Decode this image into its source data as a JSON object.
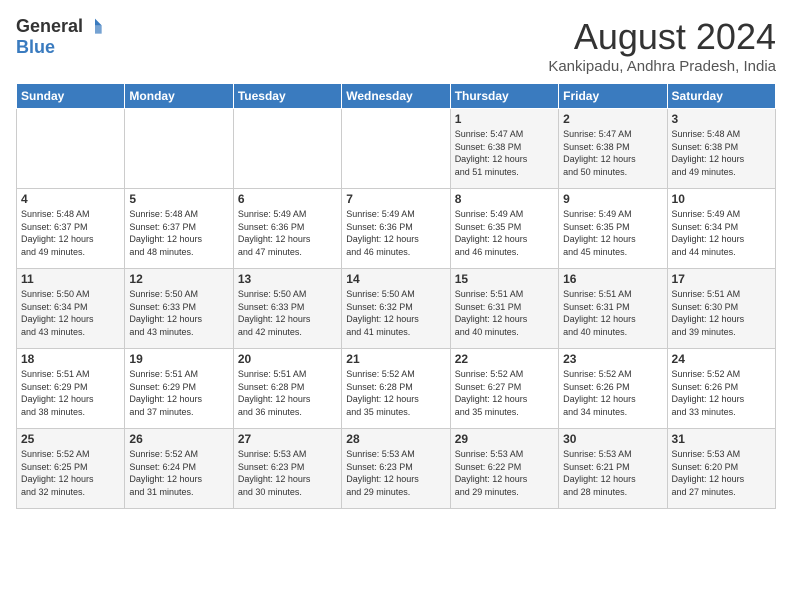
{
  "logo": {
    "general": "General",
    "blue": "Blue"
  },
  "title": {
    "month_year": "August 2024",
    "location": "Kankipadu, Andhra Pradesh, India"
  },
  "days_of_week": [
    "Sunday",
    "Monday",
    "Tuesday",
    "Wednesday",
    "Thursday",
    "Friday",
    "Saturday"
  ],
  "weeks": [
    [
      {
        "day": "",
        "info": ""
      },
      {
        "day": "",
        "info": ""
      },
      {
        "day": "",
        "info": ""
      },
      {
        "day": "",
        "info": ""
      },
      {
        "day": "1",
        "info": "Sunrise: 5:47 AM\nSunset: 6:38 PM\nDaylight: 12 hours\nand 51 minutes."
      },
      {
        "day": "2",
        "info": "Sunrise: 5:47 AM\nSunset: 6:38 PM\nDaylight: 12 hours\nand 50 minutes."
      },
      {
        "day": "3",
        "info": "Sunrise: 5:48 AM\nSunset: 6:38 PM\nDaylight: 12 hours\nand 49 minutes."
      }
    ],
    [
      {
        "day": "4",
        "info": "Sunrise: 5:48 AM\nSunset: 6:37 PM\nDaylight: 12 hours\nand 49 minutes."
      },
      {
        "day": "5",
        "info": "Sunrise: 5:48 AM\nSunset: 6:37 PM\nDaylight: 12 hours\nand 48 minutes."
      },
      {
        "day": "6",
        "info": "Sunrise: 5:49 AM\nSunset: 6:36 PM\nDaylight: 12 hours\nand 47 minutes."
      },
      {
        "day": "7",
        "info": "Sunrise: 5:49 AM\nSunset: 6:36 PM\nDaylight: 12 hours\nand 46 minutes."
      },
      {
        "day": "8",
        "info": "Sunrise: 5:49 AM\nSunset: 6:35 PM\nDaylight: 12 hours\nand 46 minutes."
      },
      {
        "day": "9",
        "info": "Sunrise: 5:49 AM\nSunset: 6:35 PM\nDaylight: 12 hours\nand 45 minutes."
      },
      {
        "day": "10",
        "info": "Sunrise: 5:49 AM\nSunset: 6:34 PM\nDaylight: 12 hours\nand 44 minutes."
      }
    ],
    [
      {
        "day": "11",
        "info": "Sunrise: 5:50 AM\nSunset: 6:34 PM\nDaylight: 12 hours\nand 43 minutes."
      },
      {
        "day": "12",
        "info": "Sunrise: 5:50 AM\nSunset: 6:33 PM\nDaylight: 12 hours\nand 43 minutes."
      },
      {
        "day": "13",
        "info": "Sunrise: 5:50 AM\nSunset: 6:33 PM\nDaylight: 12 hours\nand 42 minutes."
      },
      {
        "day": "14",
        "info": "Sunrise: 5:50 AM\nSunset: 6:32 PM\nDaylight: 12 hours\nand 41 minutes."
      },
      {
        "day": "15",
        "info": "Sunrise: 5:51 AM\nSunset: 6:31 PM\nDaylight: 12 hours\nand 40 minutes."
      },
      {
        "day": "16",
        "info": "Sunrise: 5:51 AM\nSunset: 6:31 PM\nDaylight: 12 hours\nand 40 minutes."
      },
      {
        "day": "17",
        "info": "Sunrise: 5:51 AM\nSunset: 6:30 PM\nDaylight: 12 hours\nand 39 minutes."
      }
    ],
    [
      {
        "day": "18",
        "info": "Sunrise: 5:51 AM\nSunset: 6:29 PM\nDaylight: 12 hours\nand 38 minutes."
      },
      {
        "day": "19",
        "info": "Sunrise: 5:51 AM\nSunset: 6:29 PM\nDaylight: 12 hours\nand 37 minutes."
      },
      {
        "day": "20",
        "info": "Sunrise: 5:51 AM\nSunset: 6:28 PM\nDaylight: 12 hours\nand 36 minutes."
      },
      {
        "day": "21",
        "info": "Sunrise: 5:52 AM\nSunset: 6:28 PM\nDaylight: 12 hours\nand 35 minutes."
      },
      {
        "day": "22",
        "info": "Sunrise: 5:52 AM\nSunset: 6:27 PM\nDaylight: 12 hours\nand 35 minutes."
      },
      {
        "day": "23",
        "info": "Sunrise: 5:52 AM\nSunset: 6:26 PM\nDaylight: 12 hours\nand 34 minutes."
      },
      {
        "day": "24",
        "info": "Sunrise: 5:52 AM\nSunset: 6:26 PM\nDaylight: 12 hours\nand 33 minutes."
      }
    ],
    [
      {
        "day": "25",
        "info": "Sunrise: 5:52 AM\nSunset: 6:25 PM\nDaylight: 12 hours\nand 32 minutes."
      },
      {
        "day": "26",
        "info": "Sunrise: 5:52 AM\nSunset: 6:24 PM\nDaylight: 12 hours\nand 31 minutes."
      },
      {
        "day": "27",
        "info": "Sunrise: 5:53 AM\nSunset: 6:23 PM\nDaylight: 12 hours\nand 30 minutes."
      },
      {
        "day": "28",
        "info": "Sunrise: 5:53 AM\nSunset: 6:23 PM\nDaylight: 12 hours\nand 29 minutes."
      },
      {
        "day": "29",
        "info": "Sunrise: 5:53 AM\nSunset: 6:22 PM\nDaylight: 12 hours\nand 29 minutes."
      },
      {
        "day": "30",
        "info": "Sunrise: 5:53 AM\nSunset: 6:21 PM\nDaylight: 12 hours\nand 28 minutes."
      },
      {
        "day": "31",
        "info": "Sunrise: 5:53 AM\nSunset: 6:20 PM\nDaylight: 12 hours\nand 27 minutes."
      }
    ]
  ]
}
